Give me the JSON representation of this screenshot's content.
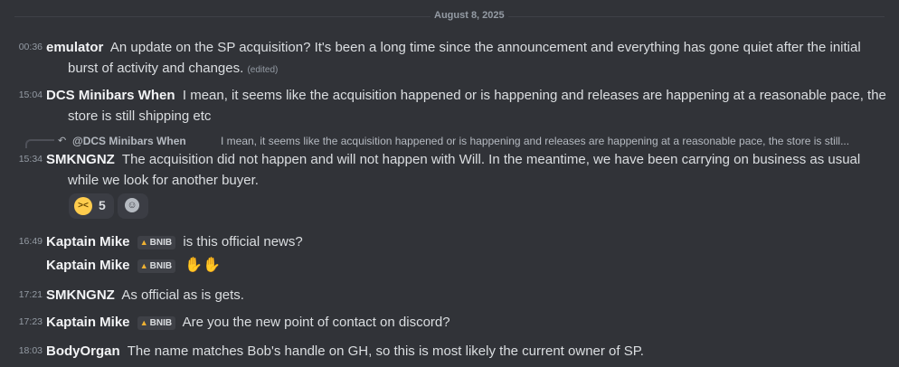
{
  "date_divider": "August 8, 2025",
  "messages": [
    {
      "time": "00:36",
      "author": "emulator",
      "text1": "An update on the SP acquisition? It's been a long time since the announcement and everything has gone quiet after the initial",
      "text2": "burst of activity and changes.",
      "edited": "(edited)"
    },
    {
      "time": "15:04",
      "author": "DCS Minibars When",
      "text1": "I mean, it seems like the acquisition happened or is happening and releases are happening at a reasonable pace, the",
      "text2": "store is still shipping etc"
    },
    {
      "time": "15:34",
      "author": "SMKNGNZ",
      "text1": "The acquisition did not happen and will not happen with Will. In the meantime, we have been carrying on business as usual",
      "text2": "while we look for another buyer."
    },
    {
      "time": "16:49",
      "author": "Kaptain Mike",
      "tag": "BNIB",
      "text1": "is this official news?"
    },
    {
      "time": "",
      "author": "Kaptain Mike",
      "tag": "BNIB",
      "emoji": "raising-hands-emoji"
    },
    {
      "time": "17:21",
      "author": "SMKNGNZ",
      "text1": "As official as is gets."
    },
    {
      "time": "17:23",
      "author": "Kaptain Mike",
      "tag": "BNIB",
      "text1": "Are you the new point of contact on discord?"
    },
    {
      "time": "18:03",
      "author": "BodyOrgan",
      "text1": "The name matches Bob's handle on GH, so this is most likely the current owner of SP."
    }
  ],
  "reply": {
    "author": "@DCS Minibars When",
    "text": "I mean, it seems like the acquisition happened or is happening and releases are happening at a reasonable pace, the store is still..."
  },
  "reaction": {
    "emoji": "weary-face-emoji",
    "count": "5"
  },
  "add_reaction_icon": "smiley-face-icon",
  "colors": {
    "background": "#313338",
    "author": "#f2f3f5",
    "text": "#dbdee1",
    "muted": "#949ba4",
    "tag_icon": "#f0b232"
  }
}
